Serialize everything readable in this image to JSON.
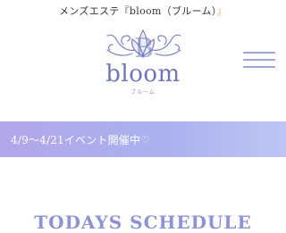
{
  "header": {
    "tagline_prefix": "メンズエステ『bloom（ブルーム）",
    "tagline_suffix": "』",
    "logo_word": "bloom",
    "logo_kana": "ブルーム",
    "logo_letter": "B"
  },
  "menu": {
    "icon": "hamburger-menu-icon"
  },
  "banner": {
    "text": "4/9〜4/21イベント開催中♡"
  },
  "schedule": {
    "title": "TODAYS SCHEDULE"
  },
  "colors": {
    "accent": "#8e93d2",
    "tagline_accent": "#d9a548",
    "banner_start": "#b3a6e9",
    "banner_end": "#bcc6f4"
  }
}
